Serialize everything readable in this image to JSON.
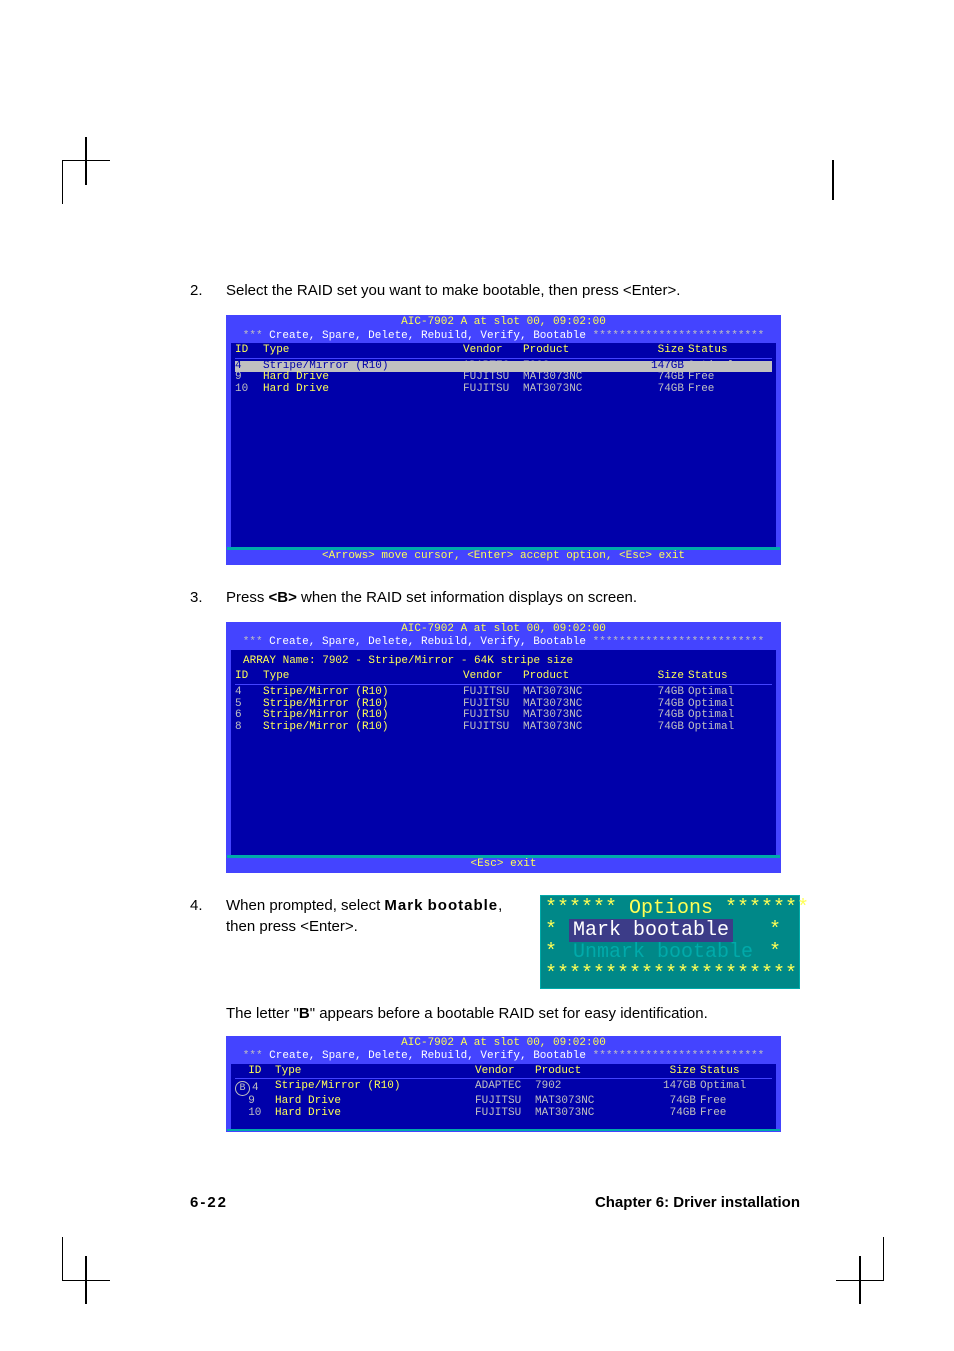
{
  "page": {
    "number": "6-22",
    "chapter": "Chapter 6: Driver installation"
  },
  "steps": {
    "s2": {
      "num": "2.",
      "text": "Select the RAID set you want to make bootable, then press <Enter>."
    },
    "s3": {
      "num": "3.",
      "text_before": "Press ",
      "key": "<B>",
      "text_after": " when the RAID set information displays on screen."
    },
    "s4": {
      "num": "4.",
      "text_before": "When prompted, select ",
      "bold1": "Mark",
      "bold2": "bootable",
      "text_after": ", then press <Enter>."
    },
    "note": {
      "before": "The letter \"",
      "letter": "B",
      "after": "\" appears before a bootable RAID set for easy identification."
    }
  },
  "bios_common": {
    "title": "AIC-7902 A at slot 00, 09:02:00",
    "menu": "Create, Spare, Delete, Rebuild, Verify, Bootable",
    "cols": {
      "id": "ID",
      "type": "Type",
      "vendor": "Vendor",
      "product": "Product",
      "size": "Size",
      "status": "Status"
    }
  },
  "bios1": {
    "rows": [
      {
        "id": "4",
        "type": "Stripe/Mirror (R10)",
        "vendor": "ADAPTEC",
        "product": "7902",
        "size": "147GB",
        "status": "Optimal",
        "sel": true
      },
      {
        "id": "9",
        "type": "Hard Drive",
        "vendor": "FUJITSU",
        "product": "MAT3073NC",
        "size": "74GB",
        "status": "Free"
      },
      {
        "id": "10",
        "type": "Hard Drive",
        "vendor": "FUJITSU",
        "product": "MAT3073NC",
        "size": "74GB",
        "status": "Free"
      }
    ],
    "footer": "<Arrows> move cursor, <Enter> accept option, <Esc> exit"
  },
  "bios2": {
    "array_name": "ARRAY Name: 7902 - Stripe/Mirror - 64K stripe size",
    "rows": [
      {
        "id": "4",
        "type": "Stripe/Mirror (R10)",
        "vendor": "FUJITSU",
        "product": "MAT3073NC",
        "size": "74GB",
        "status": "Optimal"
      },
      {
        "id": "5",
        "type": "Stripe/Mirror (R10)",
        "vendor": "FUJITSU",
        "product": "MAT3073NC",
        "size": "74GB",
        "status": "Optimal"
      },
      {
        "id": "6",
        "type": "Stripe/Mirror (R10)",
        "vendor": "FUJITSU",
        "product": "MAT3073NC",
        "size": "74GB",
        "status": "Optimal"
      },
      {
        "id": "8",
        "type": "Stripe/Mirror (R10)",
        "vendor": "FUJITSU",
        "product": "MAT3073NC",
        "size": "74GB",
        "status": "Optimal"
      }
    ],
    "footer": "<Esc> exit"
  },
  "options_popup": {
    "title": " Options ",
    "items": [
      {
        "label": "Mark bootable",
        "sel": true
      },
      {
        "label": "Unmark bootable",
        "sel": false
      }
    ],
    "star_top": "******         *******",
    "star_bot": "*********************"
  },
  "bios3": {
    "rows": [
      {
        "mark": "B",
        "id": "4",
        "type": "Stripe/Mirror (R10)",
        "vendor": "ADAPTEC",
        "product": "7902",
        "size": "147GB",
        "status": "Optimal"
      },
      {
        "mark": "",
        "id": "9",
        "type": "Hard Drive",
        "vendor": "FUJITSU",
        "product": "MAT3073NC",
        "size": "74GB",
        "status": "Free"
      },
      {
        "mark": "",
        "id": "10",
        "type": "Hard Drive",
        "vendor": "FUJITSU",
        "product": "MAT3073NC",
        "size": "74GB",
        "status": "Free"
      }
    ]
  }
}
